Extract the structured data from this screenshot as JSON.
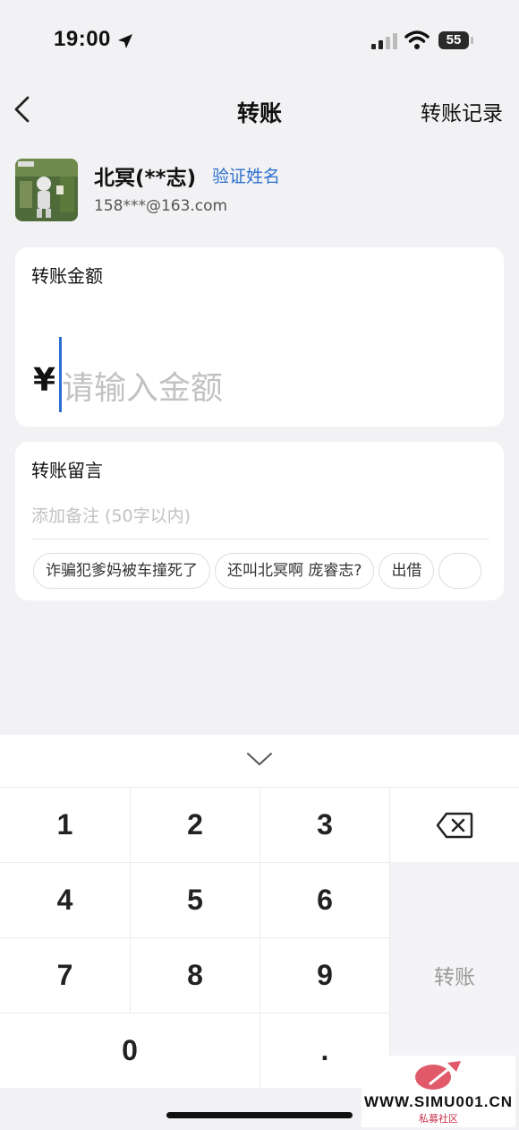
{
  "status_bar": {
    "time": "19:00",
    "battery": "55"
  },
  "nav": {
    "title": "转账",
    "right_link": "转账记录"
  },
  "payee": {
    "name": "北冥(**志)",
    "verify_link": "验证姓名",
    "account": "158***@163.com"
  },
  "amount": {
    "label": "转账金额",
    "currency": "¥",
    "placeholder": "请输入金额"
  },
  "message": {
    "label": "转账留言",
    "placeholder": "添加备注 (50字以内)",
    "suggestions": [
      "诈骗犯爹妈被车撞死了",
      "还叫北冥啊 庞睿志?",
      "出借"
    ]
  },
  "keypad": {
    "keys": [
      "1",
      "2",
      "3",
      "4",
      "5",
      "6",
      "7",
      "8",
      "9",
      "0",
      "."
    ],
    "submit_label": "转账"
  },
  "watermark": {
    "text": "WWW.SIMU001.CN",
    "sub": "私募社区"
  },
  "colors": {
    "accent": "#2c6fd1",
    "background": "#f2f2f4",
    "card": "#ffffff"
  }
}
